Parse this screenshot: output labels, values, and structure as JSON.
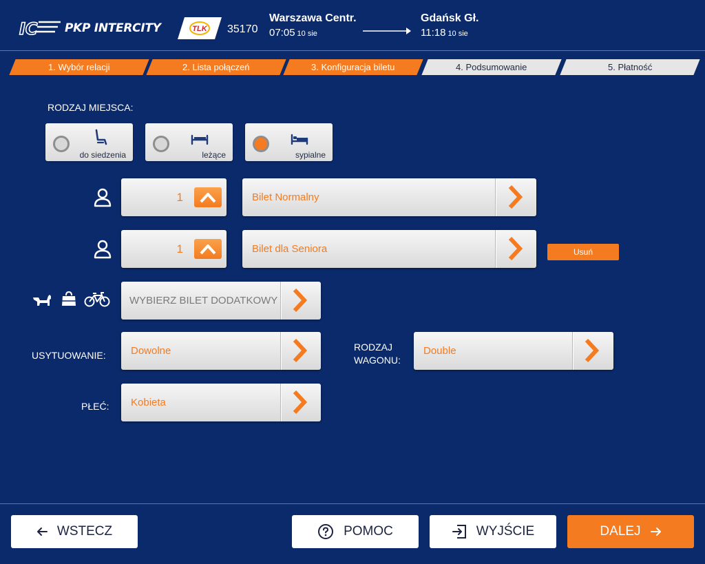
{
  "header": {
    "brand_name": "PKP INTERCITY",
    "brand_logo_text": "IC",
    "train_category": "TLK",
    "train_number": "35170",
    "from": {
      "station": "Warszawa Centr.",
      "time": "07:05",
      "date": "10 sie"
    },
    "to": {
      "station": "Gdańsk Gł.",
      "time": "11:18",
      "date": "10 sie"
    }
  },
  "steps": [
    {
      "label": "1. Wybór relacji",
      "state": "done"
    },
    {
      "label": "2. Lista połączeń",
      "state": "done"
    },
    {
      "label": "3. Konfiguracja biletu",
      "state": "current"
    },
    {
      "label": "4. Podsumowanie",
      "state": "todo"
    },
    {
      "label": "5. Płatność",
      "state": "todo"
    }
  ],
  "seat_type": {
    "label": "RODZAJ MIEJSCA:",
    "options": [
      {
        "label": "do siedzenia",
        "icon": "seat-icon",
        "selected": false
      },
      {
        "label": "leżące",
        "icon": "couchette-icon",
        "selected": false
      },
      {
        "label": "sypialne",
        "icon": "sleeper-icon",
        "selected": true
      }
    ]
  },
  "passengers": [
    {
      "quantity": "1",
      "ticket": "Bilet Normalny",
      "removable": false
    },
    {
      "quantity": "1",
      "ticket": "Bilet dla Seniora",
      "removable": true,
      "remove_label": "Usuń"
    }
  ],
  "extra_ticket": {
    "icons": [
      "dog-icon",
      "luggage-icon",
      "bicycle-icon"
    ],
    "placeholder": "WYBIERZ BILET DODATKOWY"
  },
  "placement": {
    "label": "USYTUOWANIE:",
    "value": "Dowolne"
  },
  "wagon_type": {
    "label_line1": "RODZAJ",
    "label_line2": "WAGONU:",
    "value": "Double"
  },
  "gender": {
    "label": "PŁEĆ:",
    "value": "Kobieta"
  },
  "footer": {
    "back": "WSTECZ",
    "help": "POMOC",
    "exit": "WYJŚCIE",
    "next": "DALEJ"
  },
  "colors": {
    "background": "#0b2a6b",
    "accent": "#f47b20",
    "inactive_step": "#e6e6e6"
  }
}
